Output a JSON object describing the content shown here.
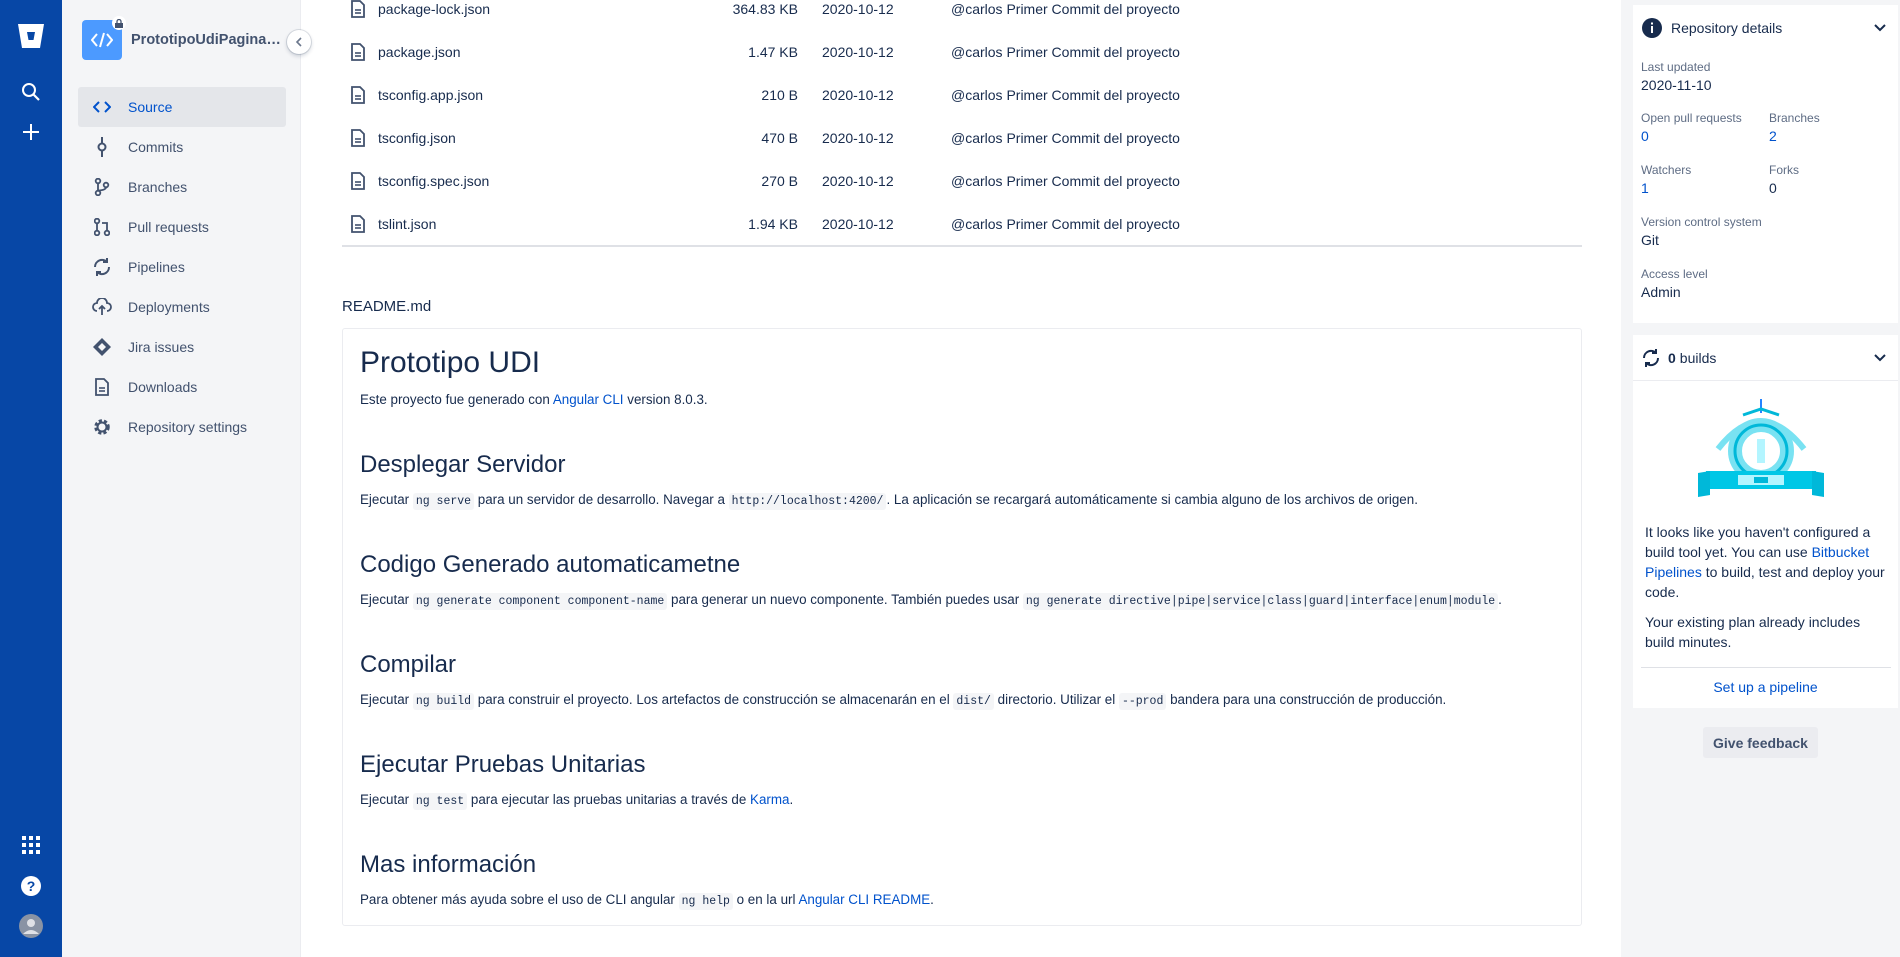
{
  "project": {
    "name": "PrototipoUdiPaginaWeb"
  },
  "nav": [
    {
      "label": "Source",
      "icon": "code-icon",
      "active": true
    },
    {
      "label": "Commits",
      "icon": "commit-icon"
    },
    {
      "label": "Branches",
      "icon": "branch-icon"
    },
    {
      "label": "Pull requests",
      "icon": "pull-request-icon"
    },
    {
      "label": "Pipelines",
      "icon": "pipelines-icon"
    },
    {
      "label": "Deployments",
      "icon": "deployments-icon"
    },
    {
      "label": "Jira issues",
      "icon": "jira-icon"
    },
    {
      "label": "Downloads",
      "icon": "downloads-icon"
    },
    {
      "label": "Repository settings",
      "icon": "gear-icon"
    }
  ],
  "files": [
    {
      "name": "package-lock.json",
      "size": "364.83 KB",
      "date": "2020-10-12",
      "message": "@carlos Primer Commit del proyecto"
    },
    {
      "name": "package.json",
      "size": "1.47 KB",
      "date": "2020-10-12",
      "message": "@carlos Primer Commit del proyecto"
    },
    {
      "name": "tsconfig.app.json",
      "size": "210 B",
      "date": "2020-10-12",
      "message": "@carlos Primer Commit del proyecto"
    },
    {
      "name": "tsconfig.json",
      "size": "470 B",
      "date": "2020-10-12",
      "message": "@carlos Primer Commit del proyecto"
    },
    {
      "name": "tsconfig.spec.json",
      "size": "270 B",
      "date": "2020-10-12",
      "message": "@carlos Primer Commit del proyecto"
    },
    {
      "name": "tslint.json",
      "size": "1.94 KB",
      "date": "2020-10-12",
      "message": "@carlos Primer Commit del proyecto"
    }
  ],
  "readme": {
    "label": "README.md",
    "title": "Prototipo UDI",
    "intro": {
      "pre": "Este proyecto fue generado con ",
      "link": "Angular CLI",
      "post": " version 8.0.3."
    },
    "s1": {
      "heading": "Desplegar Servidor",
      "t1": "Ejecutar ",
      "c1": "ng serve",
      "t2": " para un servidor de desarrollo. Navegar a ",
      "c2": "http://localhost:4200/",
      "t3": ". La aplicación se recargará automáticamente si cambia alguno de los archivos de origen."
    },
    "s2": {
      "heading": "Codigo Generado automaticametne",
      "t1": "Ejecutar ",
      "c1": "ng generate component component-name",
      "t2": " para generar un nuevo componente. También puedes usar ",
      "c2": "ng generate directive|pipe|service|class|guard|interface|enum|module",
      "t3": "."
    },
    "s3": {
      "heading": "Compilar",
      "t1": "Ejecutar ",
      "c1": "ng build",
      "t2": " para construir el proyecto. Los artefactos de construcción se almacenarán en el ",
      "c2": "dist/",
      "t3": " directorio. Utilizar el ",
      "c3": "--prod",
      "t4": " bandera para una construcción de producción."
    },
    "s4": {
      "heading": "Ejecutar Pruebas Unitarias",
      "t1": "Ejecutar ",
      "c1": "ng test",
      "t2": " para ejecutar las pruebas unitarias a través de ",
      "link": "Karma",
      "t3": "."
    },
    "s5": {
      "heading": "Mas información",
      "t1": "Para obtener más ayuda sobre el uso de CLI angular ",
      "c1": "ng help",
      "t2": " o en la url ",
      "link": "Angular CLI README",
      "t3": "."
    }
  },
  "details": {
    "title": "Repository details",
    "last_updated_label": "Last updated",
    "last_updated": "2020-11-10",
    "open_pr_label": "Open pull requests",
    "open_pr": "0",
    "branches_label": "Branches",
    "branches": "2",
    "watchers_label": "Watchers",
    "watchers": "1",
    "forks_label": "Forks",
    "forks": "0",
    "vcs_label": "Version control system",
    "vcs": "Git",
    "access_label": "Access level",
    "access": "Admin"
  },
  "builds": {
    "count": "0",
    "label": "builds",
    "text1_pre": "It looks like you haven't configured a build tool yet. You can use ",
    "text1_link": "Bitbucket Pipelines",
    "text1_post": " to build, test and deploy your code.",
    "text2": "Your existing plan already includes build minutes.",
    "setup": "Set up a pipeline"
  },
  "feedback": "Give feedback",
  "colors": {
    "rail": "#0747a6",
    "link": "#0052cc",
    "sidebar": "#f4f5f7"
  }
}
